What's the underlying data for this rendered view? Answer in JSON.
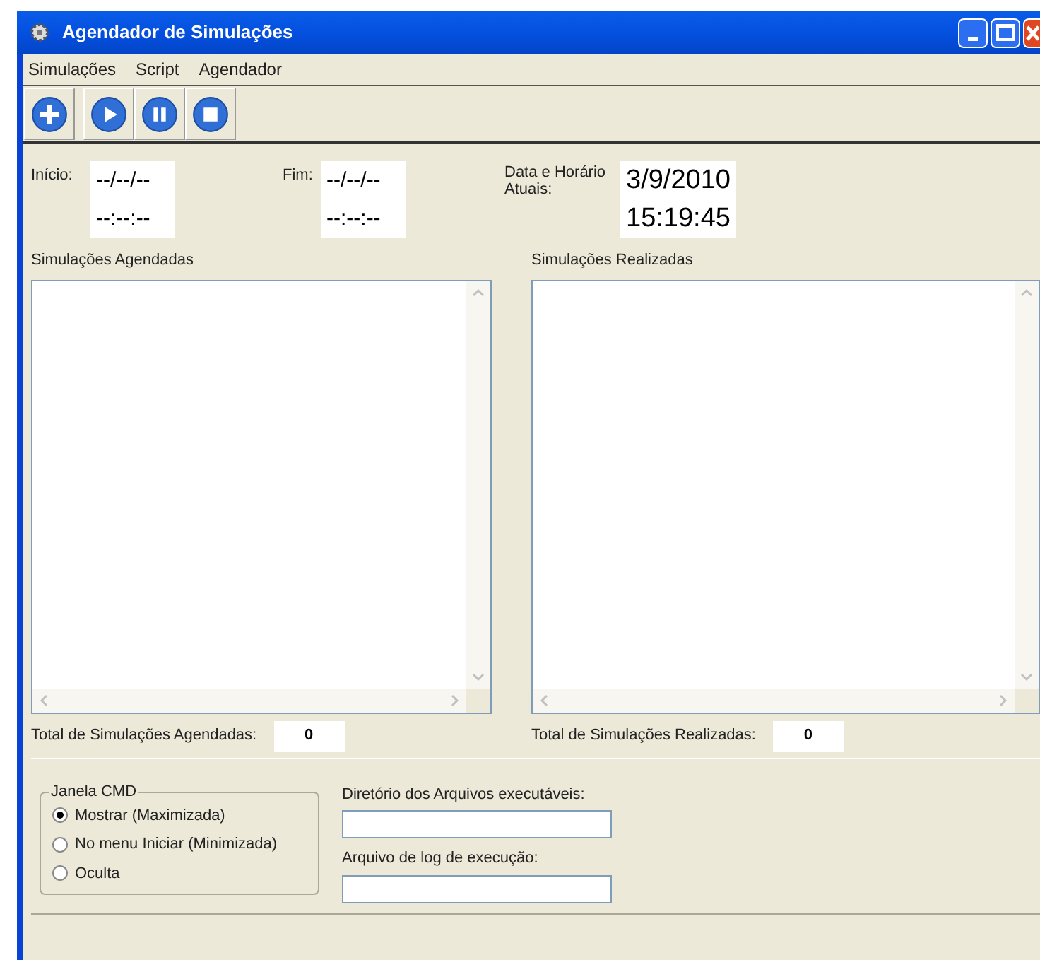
{
  "window": {
    "title": "Agendador de Simulações"
  },
  "menu": [
    "Simulações",
    "Script",
    "Agendador"
  ],
  "toolbar": [
    {
      "kind": "add"
    },
    {
      "kind": "play"
    },
    {
      "kind": "pause"
    },
    {
      "kind": "stop"
    }
  ],
  "inicio": {
    "label": "Início:",
    "date": "--/--/--",
    "time": "--:--:--"
  },
  "fim": {
    "label": "Fim:",
    "date": "--/--/--",
    "time": "--:--:--"
  },
  "atual": {
    "label": "Data e Horário Atuais:",
    "date": "3/9/2010",
    "time": "15:19:45"
  },
  "agendadas": {
    "title": "Simulações Agendadas",
    "total_label": "Total de Simulações Agendadas:",
    "total": "0"
  },
  "realizadas": {
    "title": "Simulações Realizadas",
    "total_label": "Total de Simulações Realizadas:",
    "total": "0"
  },
  "janela_cmd": {
    "title": "Janela CMD",
    "options": [
      {
        "label": "Mostrar (Maximizada)",
        "selected": true
      },
      {
        "label": "No menu Iniciar (Minimizada)",
        "selected": false
      },
      {
        "label": "Oculta",
        "selected": false
      }
    ]
  },
  "fields": [
    {
      "label": "Diretório dos Arquivos executáveis:"
    },
    {
      "label": "Arquivo de log de execução:"
    }
  ]
}
